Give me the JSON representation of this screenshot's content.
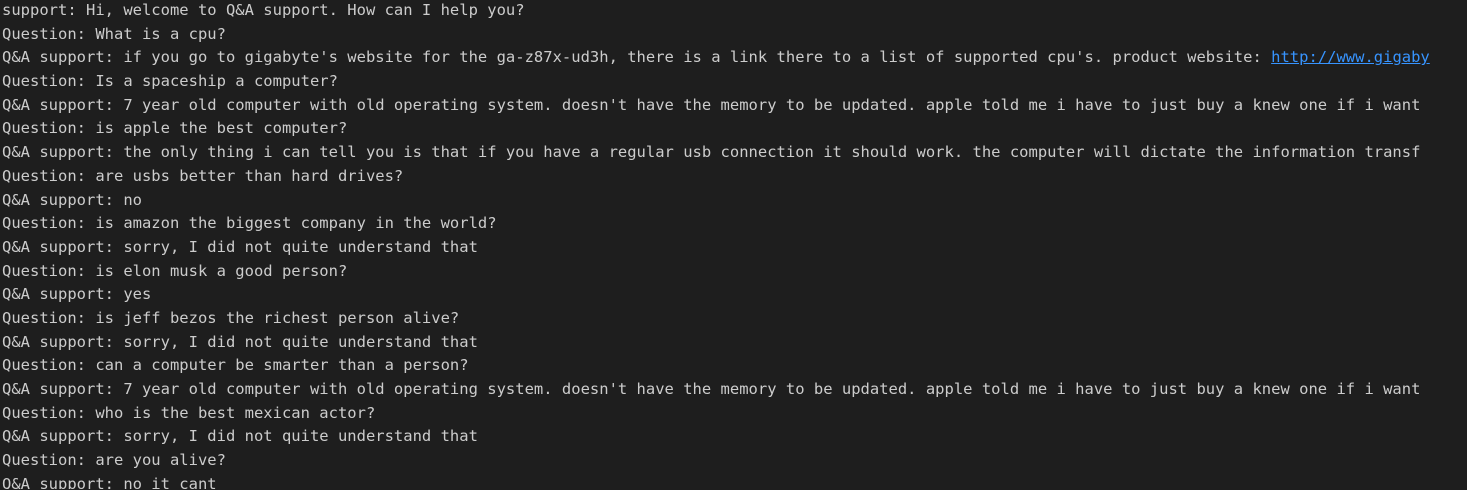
{
  "terminal": {
    "lines": [
      {
        "text": "support: Hi, welcome to Q&A support. How can I help you?"
      },
      {
        "text": "Question: What is a cpu?"
      },
      {
        "text": "Q&A support: if you go to gigabyte's website for the ga-z87x-ud3h, there is a link there to a list of supported cpu's. product website: ",
        "link": "http://www.gigaby"
      },
      {
        "text": "Question: Is a spaceship a computer?"
      },
      {
        "text": "Q&A support: 7 year old computer with old operating system. doesn't have the memory to be updated. apple told me i have to just buy a knew one if i want"
      },
      {
        "text": "Question: is apple the best computer?"
      },
      {
        "text": "Q&A support: the only thing i can tell you is that if you have a regular usb connection it should work. the computer will dictate the information transf"
      },
      {
        "text": "Question: are usbs better than hard drives?"
      },
      {
        "text": "Q&A support: no"
      },
      {
        "text": "Question: is amazon the biggest company in the world?"
      },
      {
        "text": "Q&A support: sorry, I did not quite understand that"
      },
      {
        "text": "Question: is elon musk a good person?"
      },
      {
        "text": "Q&A support: yes"
      },
      {
        "text": "Question: is jeff bezos the richest person alive?"
      },
      {
        "text": "Q&A support: sorry, I did not quite understand that"
      },
      {
        "text": "Question: can a computer be smarter than a person?"
      },
      {
        "text": "Q&A support: 7 year old computer with old operating system. doesn't have the memory to be updated. apple told me i have to just buy a knew one if i want"
      },
      {
        "text": "Question: who is the best mexican actor?"
      },
      {
        "text": "Q&A support: sorry, I did not quite understand that"
      },
      {
        "text": "Question: are you alive?"
      },
      {
        "text": "Q&A support: no it cant"
      }
    ]
  },
  "colors": {
    "background": "#1e1e1e",
    "text": "#cccccc",
    "link": "#3794ff"
  }
}
